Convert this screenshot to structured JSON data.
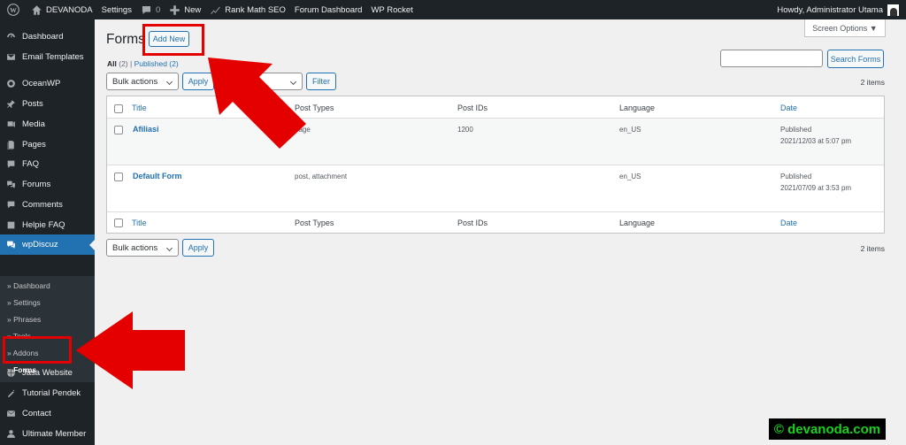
{
  "adminbar": {
    "site_name": "DEVANODA",
    "settings": "Settings",
    "comments_count": "0",
    "new_label": "New",
    "rank_math": "Rank Math SEO",
    "forum_dashboard": "Forum Dashboard",
    "wp_rocket": "WP Rocket",
    "howdy": "Howdy, Administrator Utama"
  },
  "sidebar": {
    "items": [
      {
        "label": "Dashboard",
        "icon": "dashboard-icon"
      },
      {
        "label": "Email Templates",
        "icon": "email-icon"
      },
      {
        "label": "OceanWP",
        "icon": "oceanwp-icon"
      },
      {
        "label": "Posts",
        "icon": "pin-icon"
      },
      {
        "label": "Media",
        "icon": "media-icon"
      },
      {
        "label": "Pages",
        "icon": "pages-icon"
      },
      {
        "label": "FAQ",
        "icon": "faq-icon"
      },
      {
        "label": "Forums",
        "icon": "forums-icon"
      },
      {
        "label": "Comments",
        "icon": "comments-icon"
      },
      {
        "label": "Helpie FAQ",
        "icon": "helpie-icon"
      },
      {
        "label": "wpDiscuz",
        "icon": "wpdiscuz-icon"
      },
      {
        "label": "Jasa Website",
        "icon": "jasa-icon"
      },
      {
        "label": "Tutorial Pendek",
        "icon": "tutorial-icon"
      },
      {
        "label": "Contact",
        "icon": "contact-icon"
      },
      {
        "label": "Ultimate Member",
        "icon": "member-icon"
      }
    ],
    "submenu": [
      {
        "label": "» Dashboard"
      },
      {
        "label": "» Settings"
      },
      {
        "label": "» Phrases"
      },
      {
        "label": "» Tools"
      },
      {
        "label": "» Addons"
      },
      {
        "label": "» Forms"
      }
    ]
  },
  "main": {
    "screen_options": "Screen Options ▼",
    "title": "Forms",
    "add_new": "Add New",
    "filter_all": "All",
    "filter_all_count": "(2)",
    "filter_sep": "|",
    "filter_published": "Published (2)",
    "search_button": "Search Forms",
    "bulk_actions": "Bulk actions",
    "apply": "Apply",
    "filter_button": "Filter",
    "items_count": "2 items",
    "columns": [
      "Title",
      "Post Types",
      "Post IDs",
      "Language",
      "Date"
    ],
    "rows": [
      {
        "title": "Afiliasi",
        "post_types": "page",
        "post_ids": "1200",
        "language": "en_US",
        "status": "Published",
        "date": "2021/12/03 at 5:07 pm"
      },
      {
        "title": "Default Form",
        "post_types": "post, attachment",
        "post_ids": "",
        "language": "en_US",
        "status": "Published",
        "date": "2021/07/09 at 3:53 pm"
      }
    ]
  },
  "watermark": "© devanoda.com",
  "colors": {
    "annotation": "#e50000",
    "accent": "#2271b1",
    "sidebar": "#1d2327"
  }
}
